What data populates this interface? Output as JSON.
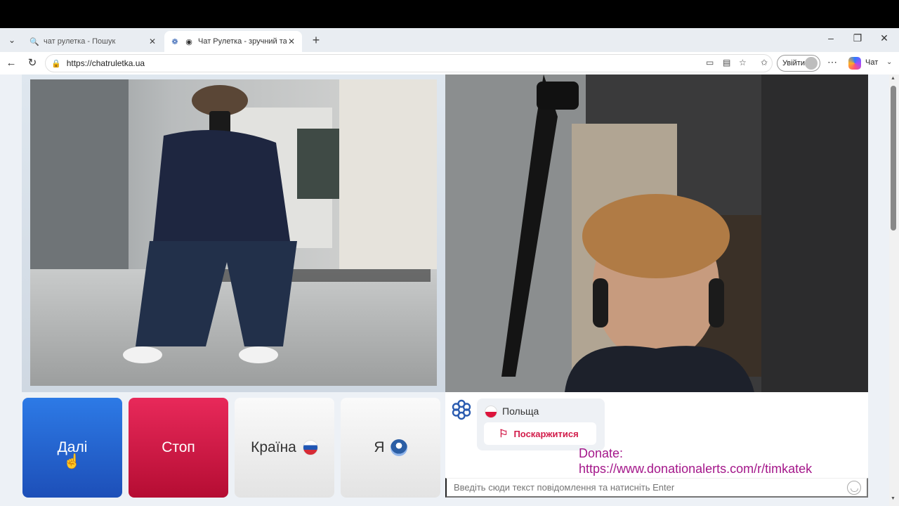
{
  "browser": {
    "tabs": [
      {
        "title": "чат рулетка - Пошук",
        "active": false
      },
      {
        "title": "Чат Рулетка - зручний та бе",
        "active": true
      }
    ],
    "url": "https://chatruletka.ua",
    "signin_label": "Увійти",
    "copilot_label": "Чат"
  },
  "controls": {
    "next_label": "Далі",
    "stop_label": "Стоп",
    "country_label": "Країна",
    "me_label": "Я"
  },
  "partner": {
    "country": "Польща",
    "report_label": "Поскаржитися"
  },
  "donate": {
    "line1": "Donate:",
    "line2": "https://www.donationalerts.com/r/timkatek"
  },
  "chat": {
    "placeholder": "Введіть сюди текст повідомлення та натисніть Enter"
  },
  "colors": {
    "next": "#1d4fb8",
    "stop": "#c8123f",
    "report": "#d21c4a",
    "donate": "#a4178a"
  }
}
